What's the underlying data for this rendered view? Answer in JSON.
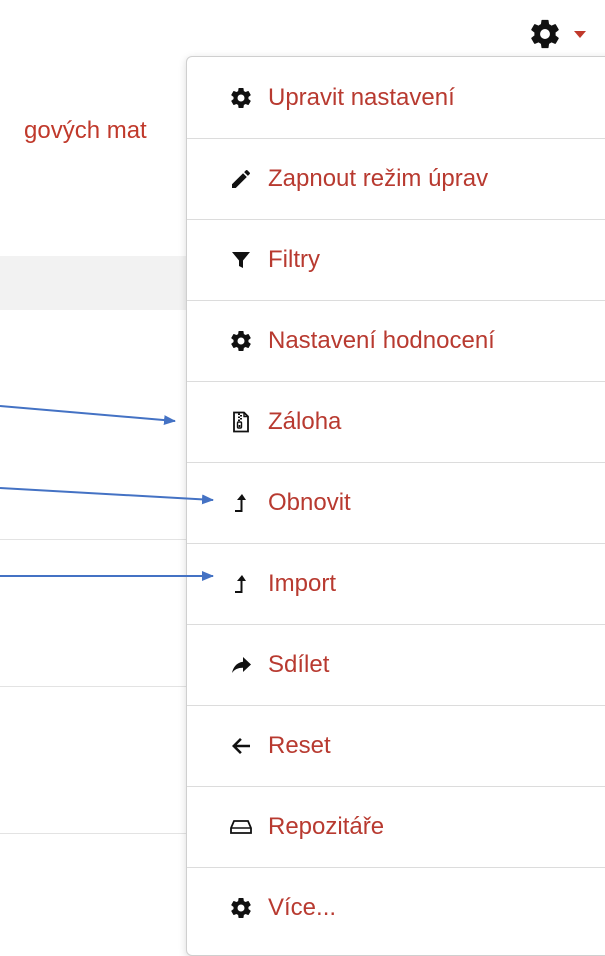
{
  "background": {
    "link_fragment": "gových mat"
  },
  "toolbar": {
    "gear_icon": "gear-icon",
    "caret_icon": "caret-down-icon"
  },
  "menu": {
    "items": [
      {
        "label": "Upravit nastavení",
        "icon": "gear-icon"
      },
      {
        "label": "Zapnout režim úprav",
        "icon": "pencil-icon"
      },
      {
        "label": "Filtry",
        "icon": "filter-icon"
      },
      {
        "label": "Nastavení hodnocení",
        "icon": "gear-icon"
      },
      {
        "label": "Záloha",
        "icon": "archive-file-icon"
      },
      {
        "label": "Obnovit",
        "icon": "level-up-icon"
      },
      {
        "label": "Import",
        "icon": "level-up-icon"
      },
      {
        "label": "Sdílet",
        "icon": "share-icon"
      },
      {
        "label": "Reset",
        "icon": "arrow-left-icon"
      },
      {
        "label": "Repozitáře",
        "icon": "hard-drive-icon"
      },
      {
        "label": "Více...",
        "icon": "gear-icon"
      }
    ]
  },
  "colors": {
    "link": "#b83a30",
    "annotation_arrow": "#4472c4"
  }
}
